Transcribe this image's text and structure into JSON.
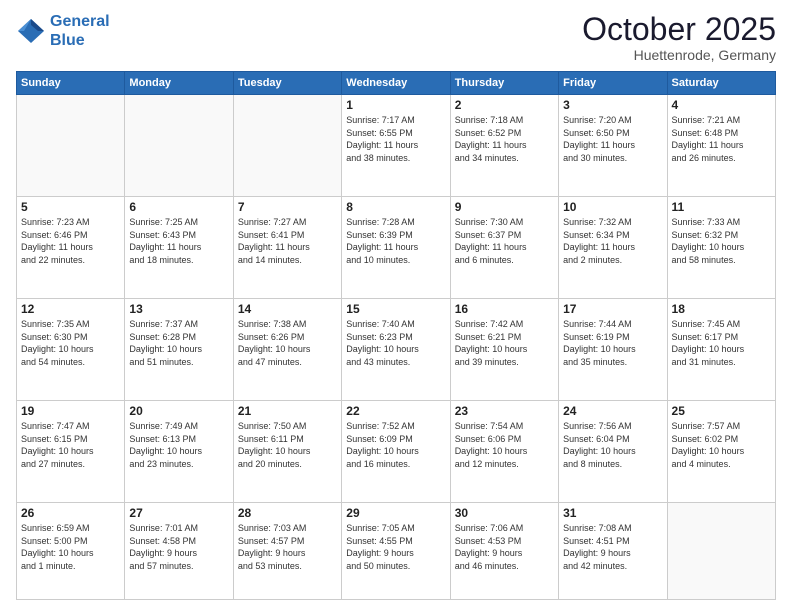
{
  "logo": {
    "line1": "General",
    "line2": "Blue"
  },
  "header": {
    "month": "October 2025",
    "location": "Huettenrode, Germany"
  },
  "weekdays": [
    "Sunday",
    "Monday",
    "Tuesday",
    "Wednesday",
    "Thursday",
    "Friday",
    "Saturday"
  ],
  "weeks": [
    [
      {
        "day": "",
        "info": ""
      },
      {
        "day": "",
        "info": ""
      },
      {
        "day": "",
        "info": ""
      },
      {
        "day": "1",
        "info": "Sunrise: 7:17 AM\nSunset: 6:55 PM\nDaylight: 11 hours\nand 38 minutes."
      },
      {
        "day": "2",
        "info": "Sunrise: 7:18 AM\nSunset: 6:52 PM\nDaylight: 11 hours\nand 34 minutes."
      },
      {
        "day": "3",
        "info": "Sunrise: 7:20 AM\nSunset: 6:50 PM\nDaylight: 11 hours\nand 30 minutes."
      },
      {
        "day": "4",
        "info": "Sunrise: 7:21 AM\nSunset: 6:48 PM\nDaylight: 11 hours\nand 26 minutes."
      }
    ],
    [
      {
        "day": "5",
        "info": "Sunrise: 7:23 AM\nSunset: 6:46 PM\nDaylight: 11 hours\nand 22 minutes."
      },
      {
        "day": "6",
        "info": "Sunrise: 7:25 AM\nSunset: 6:43 PM\nDaylight: 11 hours\nand 18 minutes."
      },
      {
        "day": "7",
        "info": "Sunrise: 7:27 AM\nSunset: 6:41 PM\nDaylight: 11 hours\nand 14 minutes."
      },
      {
        "day": "8",
        "info": "Sunrise: 7:28 AM\nSunset: 6:39 PM\nDaylight: 11 hours\nand 10 minutes."
      },
      {
        "day": "9",
        "info": "Sunrise: 7:30 AM\nSunset: 6:37 PM\nDaylight: 11 hours\nand 6 minutes."
      },
      {
        "day": "10",
        "info": "Sunrise: 7:32 AM\nSunset: 6:34 PM\nDaylight: 11 hours\nand 2 minutes."
      },
      {
        "day": "11",
        "info": "Sunrise: 7:33 AM\nSunset: 6:32 PM\nDaylight: 10 hours\nand 58 minutes."
      }
    ],
    [
      {
        "day": "12",
        "info": "Sunrise: 7:35 AM\nSunset: 6:30 PM\nDaylight: 10 hours\nand 54 minutes."
      },
      {
        "day": "13",
        "info": "Sunrise: 7:37 AM\nSunset: 6:28 PM\nDaylight: 10 hours\nand 51 minutes."
      },
      {
        "day": "14",
        "info": "Sunrise: 7:38 AM\nSunset: 6:26 PM\nDaylight: 10 hours\nand 47 minutes."
      },
      {
        "day": "15",
        "info": "Sunrise: 7:40 AM\nSunset: 6:23 PM\nDaylight: 10 hours\nand 43 minutes."
      },
      {
        "day": "16",
        "info": "Sunrise: 7:42 AM\nSunset: 6:21 PM\nDaylight: 10 hours\nand 39 minutes."
      },
      {
        "day": "17",
        "info": "Sunrise: 7:44 AM\nSunset: 6:19 PM\nDaylight: 10 hours\nand 35 minutes."
      },
      {
        "day": "18",
        "info": "Sunrise: 7:45 AM\nSunset: 6:17 PM\nDaylight: 10 hours\nand 31 minutes."
      }
    ],
    [
      {
        "day": "19",
        "info": "Sunrise: 7:47 AM\nSunset: 6:15 PM\nDaylight: 10 hours\nand 27 minutes."
      },
      {
        "day": "20",
        "info": "Sunrise: 7:49 AM\nSunset: 6:13 PM\nDaylight: 10 hours\nand 23 minutes."
      },
      {
        "day": "21",
        "info": "Sunrise: 7:50 AM\nSunset: 6:11 PM\nDaylight: 10 hours\nand 20 minutes."
      },
      {
        "day": "22",
        "info": "Sunrise: 7:52 AM\nSunset: 6:09 PM\nDaylight: 10 hours\nand 16 minutes."
      },
      {
        "day": "23",
        "info": "Sunrise: 7:54 AM\nSunset: 6:06 PM\nDaylight: 10 hours\nand 12 minutes."
      },
      {
        "day": "24",
        "info": "Sunrise: 7:56 AM\nSunset: 6:04 PM\nDaylight: 10 hours\nand 8 minutes."
      },
      {
        "day": "25",
        "info": "Sunrise: 7:57 AM\nSunset: 6:02 PM\nDaylight: 10 hours\nand 4 minutes."
      }
    ],
    [
      {
        "day": "26",
        "info": "Sunrise: 6:59 AM\nSunset: 5:00 PM\nDaylight: 10 hours\nand 1 minute."
      },
      {
        "day": "27",
        "info": "Sunrise: 7:01 AM\nSunset: 4:58 PM\nDaylight: 9 hours\nand 57 minutes."
      },
      {
        "day": "28",
        "info": "Sunrise: 7:03 AM\nSunset: 4:57 PM\nDaylight: 9 hours\nand 53 minutes."
      },
      {
        "day": "29",
        "info": "Sunrise: 7:05 AM\nSunset: 4:55 PM\nDaylight: 9 hours\nand 50 minutes."
      },
      {
        "day": "30",
        "info": "Sunrise: 7:06 AM\nSunset: 4:53 PM\nDaylight: 9 hours\nand 46 minutes."
      },
      {
        "day": "31",
        "info": "Sunrise: 7:08 AM\nSunset: 4:51 PM\nDaylight: 9 hours\nand 42 minutes."
      },
      {
        "day": "",
        "info": ""
      }
    ]
  ]
}
